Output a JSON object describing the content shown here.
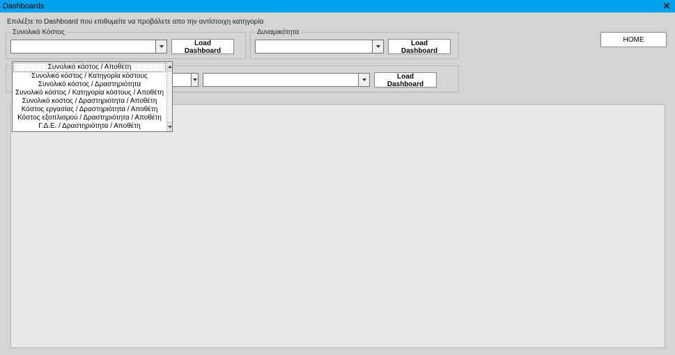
{
  "title": "Dashboards",
  "instruction": "Επιλέξτε το Dashboard που επιθυμείτε να προβάλετε απο την αντίστοιχη κατηγορία",
  "home_label": "HOME",
  "groups": {
    "total_cost": {
      "legend": "Συνολικό Κόστος",
      "load_label": "Load Dashboard"
    },
    "capacity": {
      "legend": "Δυναμικότητα",
      "load_label": "Load Dashboard"
    },
    "secondary": {
      "load_label": "Load Dashboard"
    }
  },
  "total_cost_dropdown": {
    "selected": "",
    "open": true,
    "items": [
      "Συνολικό κόστος / Αποθέτη",
      "Συνολικό κόστος / Κατηγορία κόστους",
      "Συνολικό κόστος / Δραστηριότητα",
      "Συνολικό κόστος / Κατηγορία κόστους / Αποθέτη",
      "Συνολικό κοστος / Δραστηριότητα / Αποθέτη",
      "Κόστος εργασίας / Δραστηριότητα / Αποθέτη",
      "Κόστος εξοπλισμού / Δραστηριότητα / Αποθέτη",
      "Γ.Δ.Ε. / Δραστηριότητα / Αποθέτη"
    ]
  }
}
